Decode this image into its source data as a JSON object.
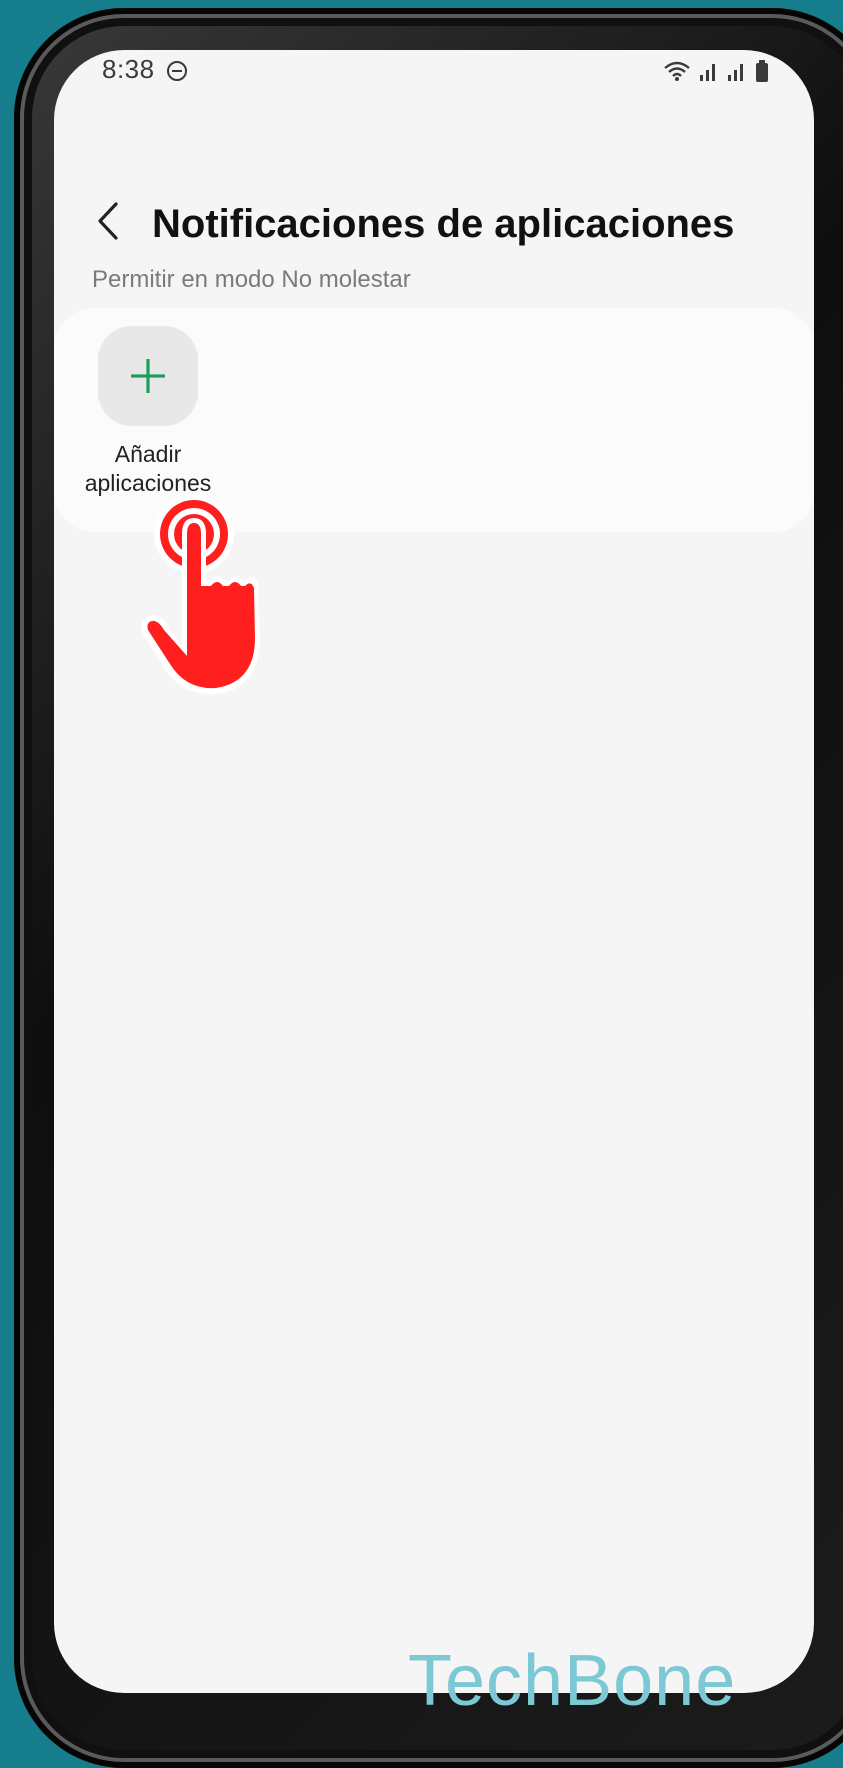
{
  "status_bar": {
    "time": "8:38",
    "icons": [
      "do-not-disturb-icon",
      "wifi-icon",
      "signal-icon",
      "signal-icon",
      "battery-icon"
    ]
  },
  "header": {
    "title": "Notificaciones de aplicaciones",
    "back_icon": "chevron-left-icon"
  },
  "section": {
    "label": "Permitir en modo No molestar"
  },
  "add_apps": {
    "label": "Añadir aplicaciones",
    "icon": "plus-icon",
    "accent": "#1e9e5a"
  },
  "overlay": {
    "icon": "tap-hand-icon",
    "color": "#ff1f1f"
  },
  "watermark": {
    "text": "TechBone",
    "color": "#7cc8d4"
  }
}
